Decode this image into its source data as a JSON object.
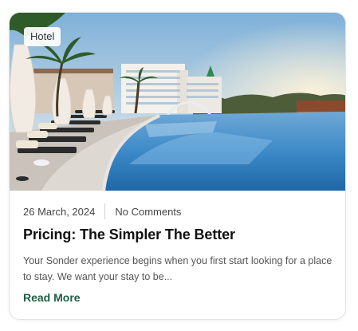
{
  "card": {
    "category": "Hotel",
    "date": "26 March, 2024",
    "comments": "No Comments",
    "title": "Pricing: The Simpler The Better",
    "excerpt": "Your Sonder experience begins when you first start looking for a place to stay. We want your stay to be...",
    "read_more": "Read More"
  },
  "colors": {
    "accent": "#1f5e46",
    "title": "#111111",
    "text": "#555555",
    "border": "#e4e4e4"
  }
}
